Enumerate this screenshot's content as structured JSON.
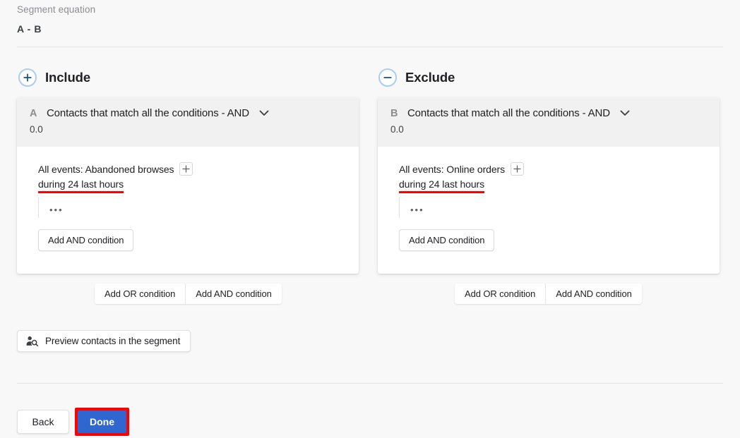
{
  "equation": {
    "label": "Segment equation",
    "value": "A  -  B"
  },
  "sections": {
    "include": {
      "title": "Include",
      "icon": "plus-circle-icon",
      "accent": "#a9cdf0"
    },
    "exclude": {
      "title": "Exclude",
      "icon": "minus-circle-icon",
      "accent": "#a9cdf0"
    }
  },
  "cards": [
    {
      "letter": "A",
      "header_title": "Contacts that match all the conditions - AND",
      "count": "0.0",
      "condition_line1": "All events: Abandoned browses",
      "condition_line2": "during 24 last hours",
      "dots": "•••",
      "add_and_label": "Add AND condition"
    },
    {
      "letter": "B",
      "header_title": "Contacts that match all the conditions - AND",
      "count": "0.0",
      "condition_line1": "All events: Online orders",
      "condition_line2": "during 24 last hours",
      "dots": "•••",
      "add_and_label": "Add AND condition"
    }
  ],
  "segmented": {
    "add_or_label": "Add OR condition",
    "add_and_label": "Add AND condition"
  },
  "preview": {
    "label": "Preview contacts in the segment",
    "icon": "person-search-icon"
  },
  "footer": {
    "back_label": "Back",
    "done_label": "Done",
    "done_color": "#3066d0",
    "highlight_color": "#ff0000"
  }
}
